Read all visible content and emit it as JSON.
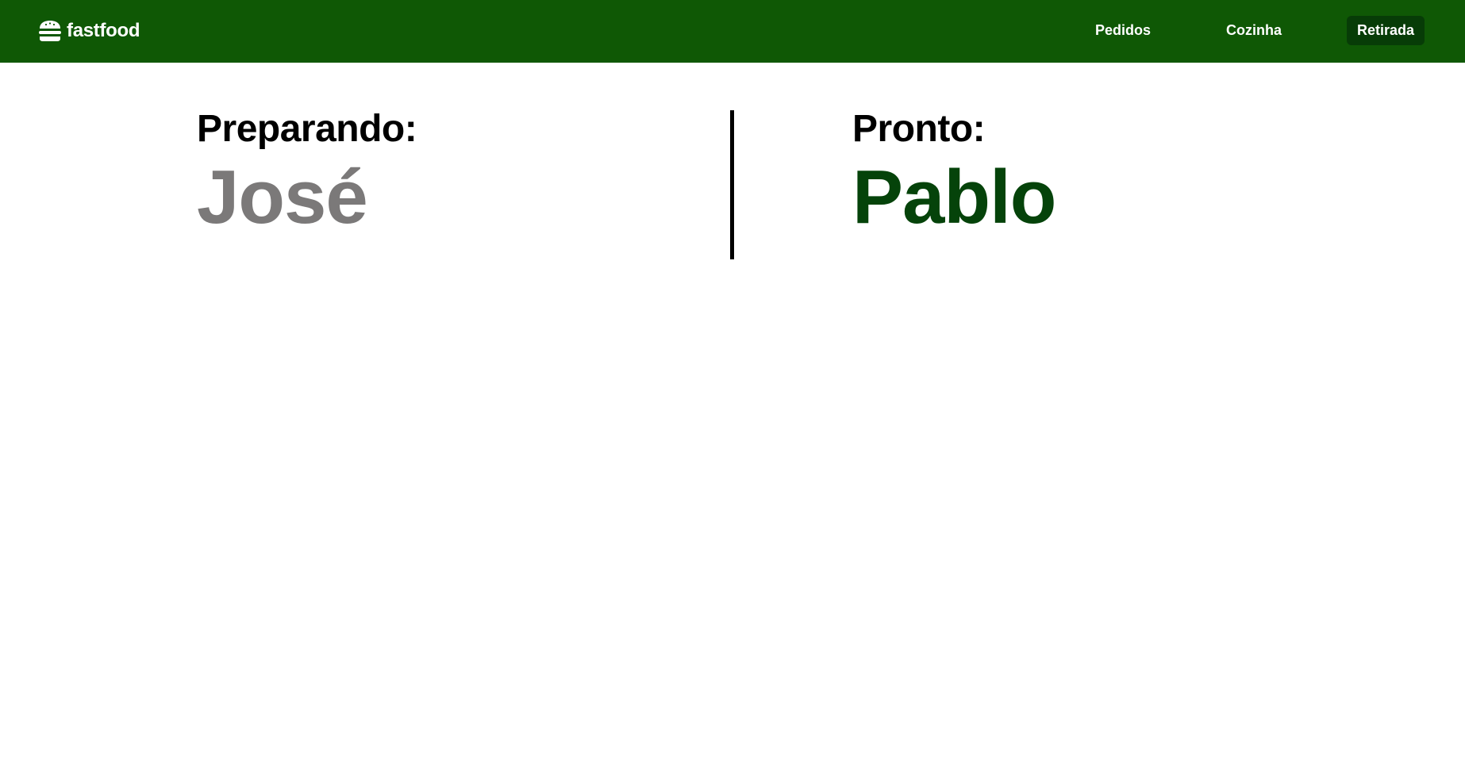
{
  "navbar": {
    "brand": "fastfood",
    "brand_icon": "burger-icon",
    "background": "#0f5805",
    "active_background": "#073c07",
    "links": [
      {
        "label": "Pedidos"
      },
      {
        "label": "Cozinha"
      },
      {
        "label": "Retirada",
        "active": true
      }
    ]
  },
  "board": {
    "preparing": {
      "title": "Preparando:",
      "names": [
        "José"
      ],
      "color": "#7b7979"
    },
    "ready": {
      "title": "Pronto:",
      "names": [
        "Pablo"
      ],
      "color": "#05430a"
    }
  }
}
